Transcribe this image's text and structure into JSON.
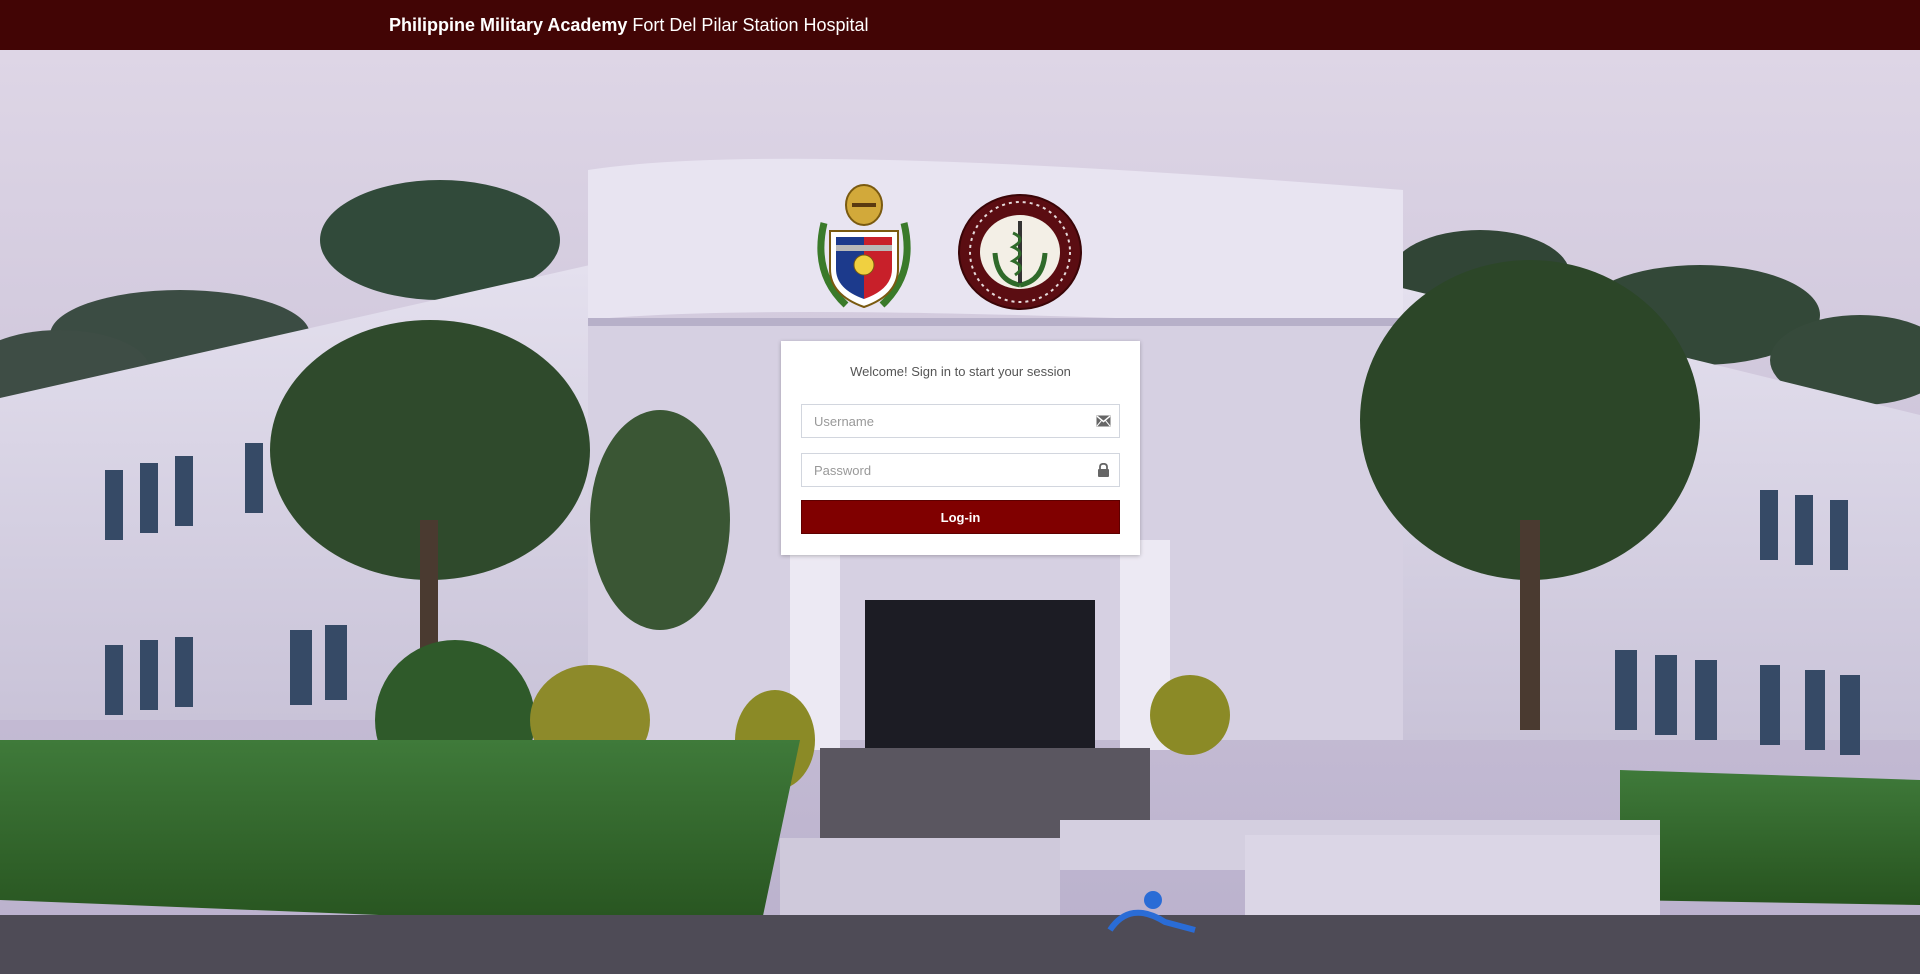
{
  "navbar": {
    "brand_strong": "Philippine Military Academy",
    "brand_rest": "Fort Del Pilar Station Hospital"
  },
  "login": {
    "message": "Welcome! Sign in to start your session",
    "username_placeholder": "Username",
    "password_placeholder": "Password",
    "button_label": "Log-in"
  },
  "icons": {
    "username": "envelope-icon",
    "password": "lock-icon"
  },
  "logos": {
    "left": "pma-crest-logo",
    "right": "fort-del-pilar-station-hospital-seal"
  },
  "colors": {
    "navbar": "#420505",
    "button": "#800000"
  }
}
